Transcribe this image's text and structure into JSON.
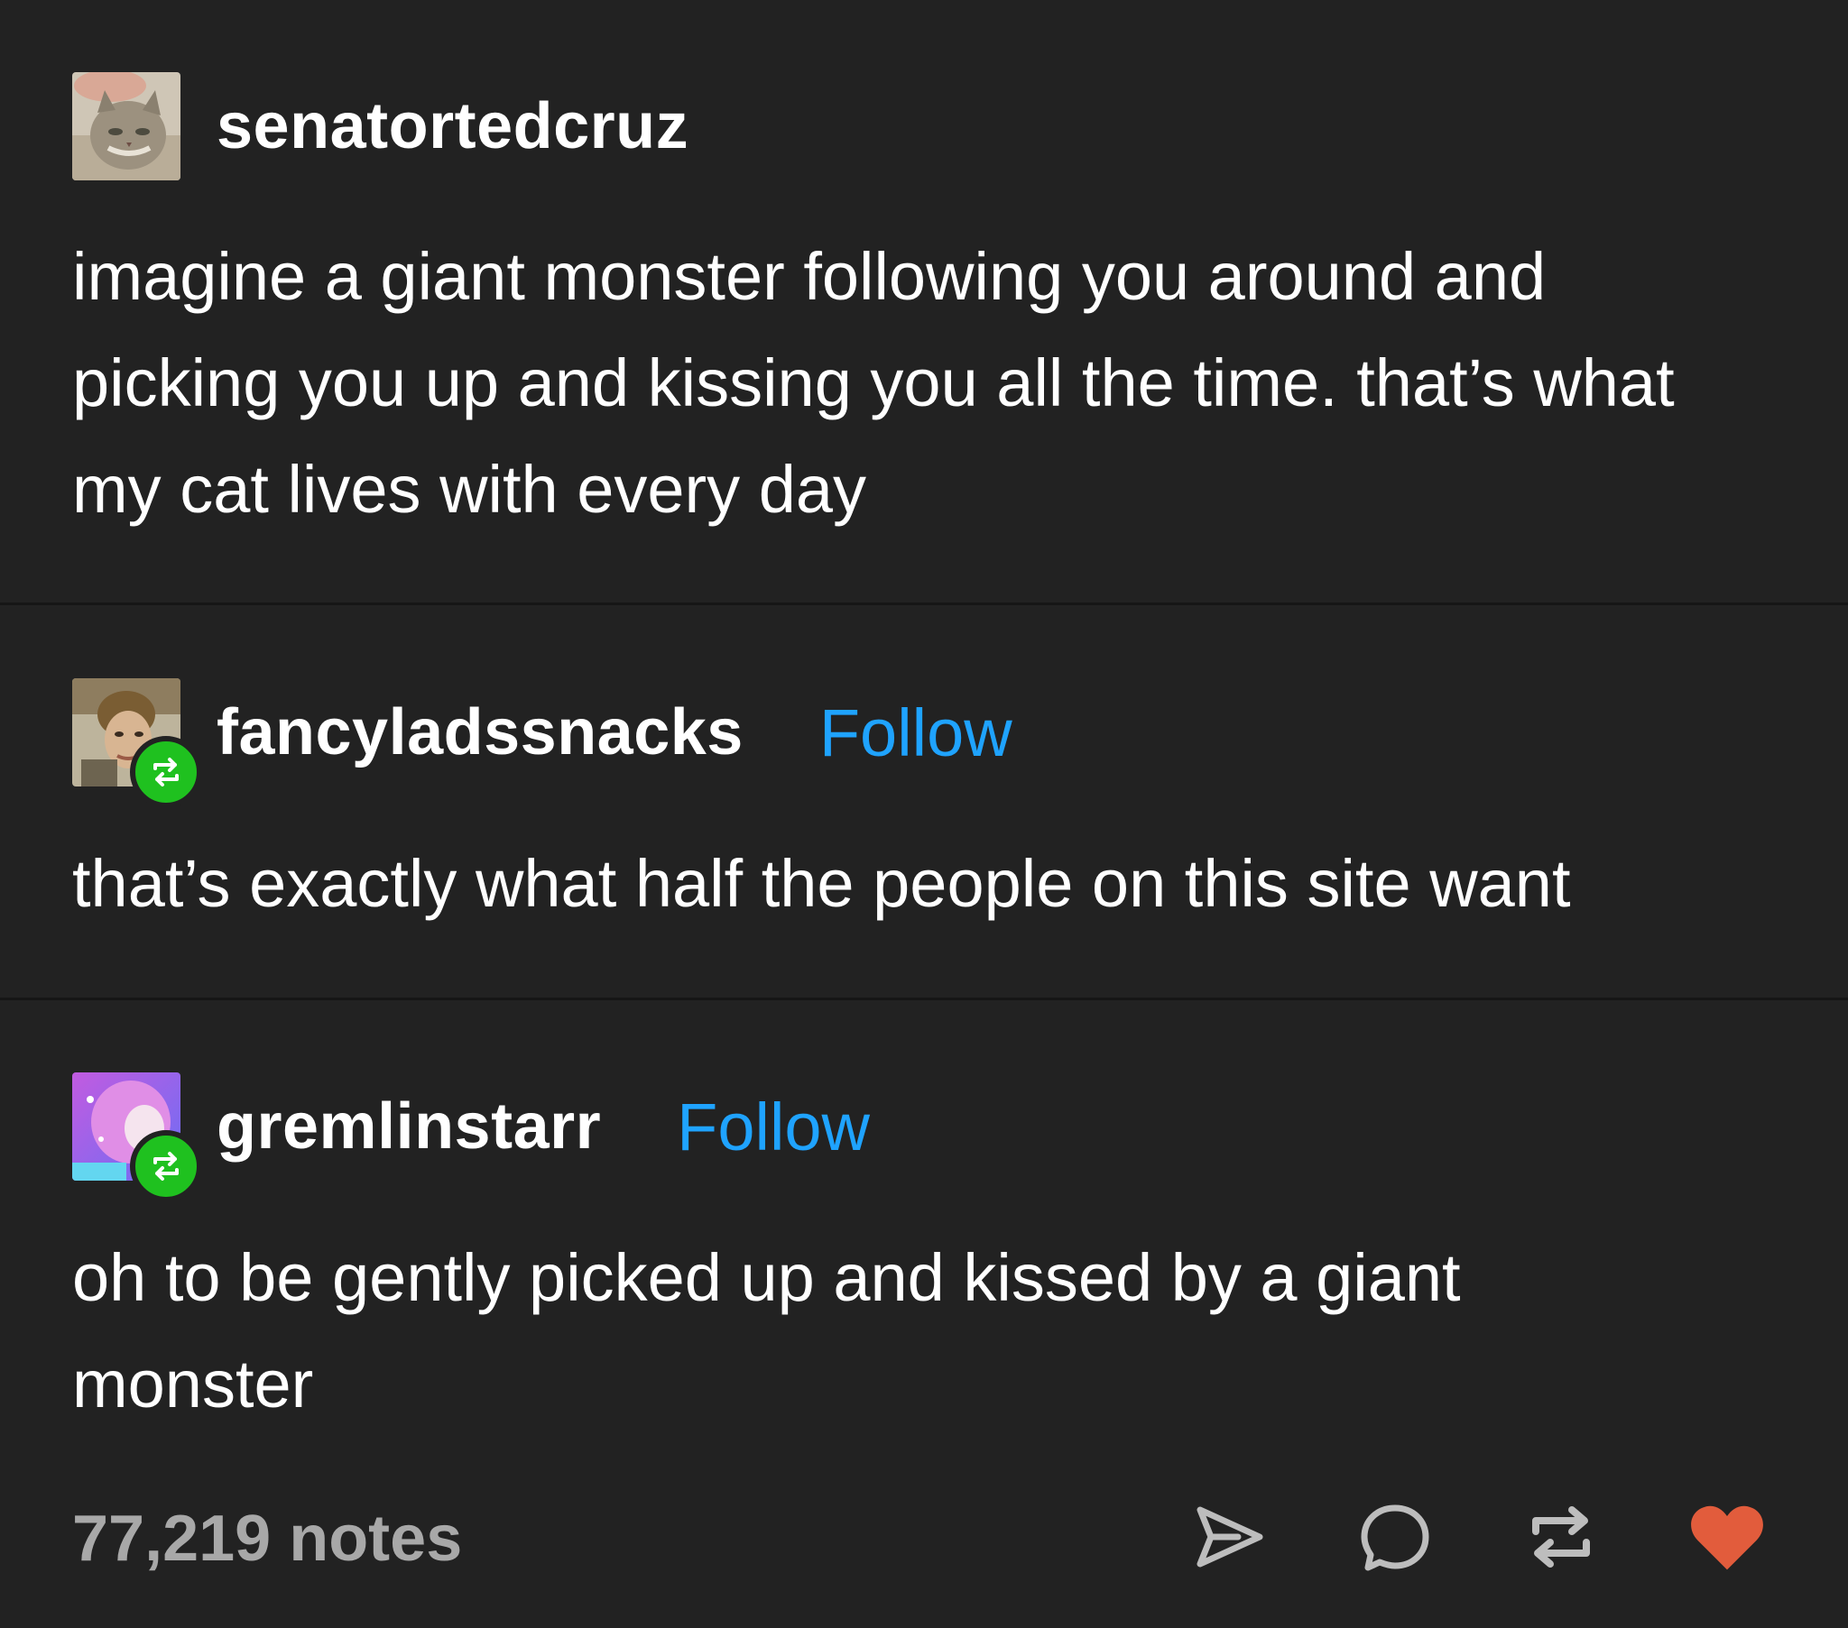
{
  "posts": [
    {
      "username": "senatortedcruz",
      "follow_label": "",
      "reblogged": false,
      "avatar_icon": "cat-avatar-icon",
      "body": "imagine a giant monster following you around and picking you up and kissing you all the time. that’s what my cat lives with every day"
    },
    {
      "username": "fancyladssnacks",
      "follow_label": "Follow",
      "reblogged": true,
      "avatar_icon": "painting-avatar-icon",
      "body": "that’s exactly what half the people on this site want"
    },
    {
      "username": "gremlinstarr",
      "follow_label": "Follow",
      "reblogged": true,
      "avatar_icon": "cartoon-avatar-icon",
      "body": "oh to be gently picked up and kissed by a giant monster"
    }
  ],
  "footer": {
    "notes": "77,219 notes",
    "actions": [
      "share-icon",
      "comment-icon",
      "reblog-icon",
      "like-heart-icon"
    ]
  },
  "colors": {
    "background": "#222222",
    "text": "#ffffff",
    "follow": "#1fa3ff",
    "reblog_badge": "#1fc11f",
    "notes": "#a8a8a8",
    "heart": "#e25c3c"
  }
}
